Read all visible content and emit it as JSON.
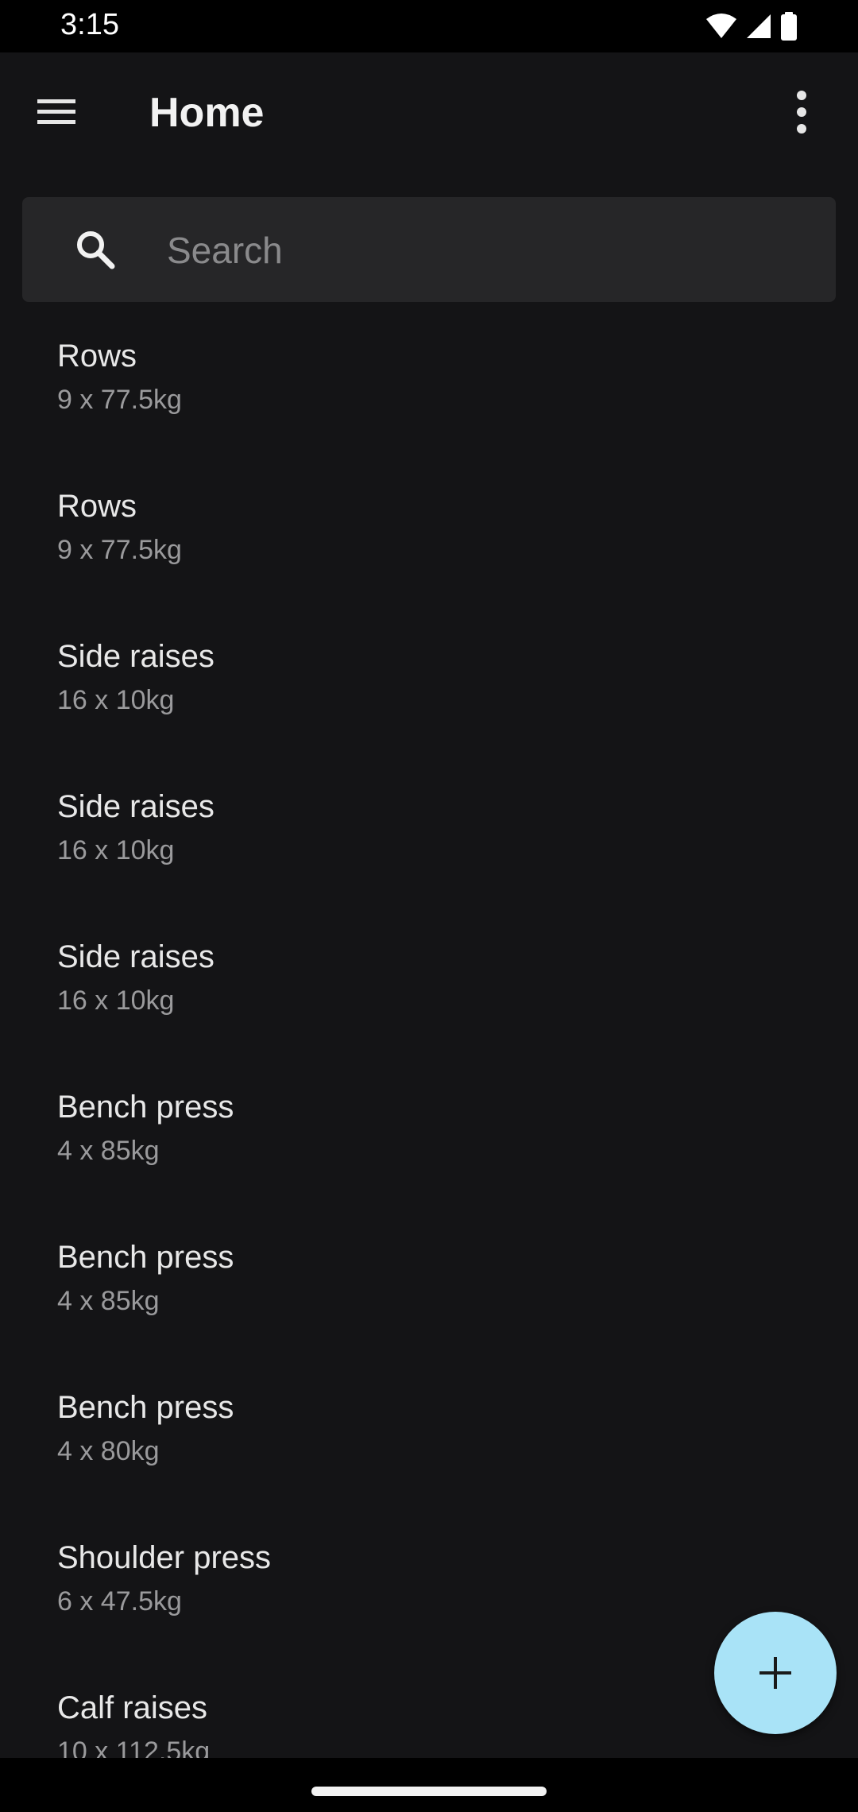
{
  "status_bar": {
    "time": "3:15",
    "icons": [
      "wifi-icon",
      "cellular-signal-icon",
      "battery-icon"
    ]
  },
  "app_bar": {
    "title": "Home",
    "menu_icon": "hamburger-menu-icon",
    "more_icon": "more-vertical-icon"
  },
  "search": {
    "placeholder": "Search",
    "value": "",
    "icon": "search-icon"
  },
  "entries": [
    {
      "name": "Rows",
      "detail": "9 x 77.5kg"
    },
    {
      "name": "Rows",
      "detail": "9 x 77.5kg"
    },
    {
      "name": "Side raises",
      "detail": "16 x 10kg"
    },
    {
      "name": "Side raises",
      "detail": "16 x 10kg"
    },
    {
      "name": "Side raises",
      "detail": "16 x 10kg"
    },
    {
      "name": "Bench press",
      "detail": "4 x 85kg"
    },
    {
      "name": "Bench press",
      "detail": "4 x 85kg"
    },
    {
      "name": "Bench press",
      "detail": "4 x 80kg"
    },
    {
      "name": "Shoulder press",
      "detail": "6 x 47.5kg"
    },
    {
      "name": "Calf raises",
      "detail": "10 x 112.5kg"
    }
  ],
  "fab": {
    "icon": "plus-icon"
  },
  "colors": {
    "background": "#141416",
    "search_background": "#262628",
    "fab": "#a9e3f7",
    "primary_text": "#e8e8e8",
    "secondary_text": "#9a9a9c"
  }
}
